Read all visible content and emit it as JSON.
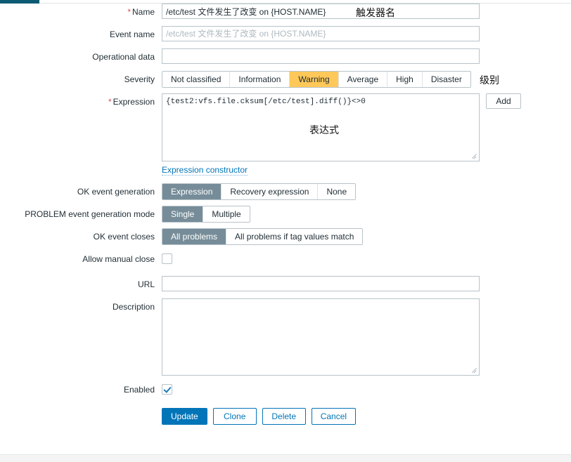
{
  "form": {
    "name": {
      "label": "Name",
      "required": true,
      "value": "/etc/test 文件发生了改变 on {HOST.NAME}",
      "annotation": "触发器名"
    },
    "event_name": {
      "label": "Event name",
      "required": false,
      "value": "",
      "placeholder": "/etc/test 文件发生了改变 on {HOST.NAME}"
    },
    "operational_data": {
      "label": "Operational data",
      "required": false,
      "value": "",
      "placeholder": ""
    },
    "severity": {
      "label": "Severity",
      "annotation": "级别",
      "selected": "Warning",
      "options": [
        "Not classified",
        "Information",
        "Warning",
        "Average",
        "High",
        "Disaster"
      ]
    },
    "expression": {
      "label": "Expression",
      "required": true,
      "value": "{test2:vfs.file.cksum[/etc/test].diff()}<>0",
      "annotation": "表达式",
      "add_label": "Add",
      "constructor_link": "Expression constructor"
    },
    "ok_event_generation": {
      "label": "OK event generation",
      "selected": "Expression",
      "options": [
        "Expression",
        "Recovery expression",
        "None"
      ]
    },
    "problem_event_generation_mode": {
      "label": "PROBLEM event generation mode",
      "selected": "Single",
      "options": [
        "Single",
        "Multiple"
      ]
    },
    "ok_event_closes": {
      "label": "OK event closes",
      "selected": "All problems",
      "options": [
        "All problems",
        "All problems if tag values match"
      ]
    },
    "allow_manual_close": {
      "label": "Allow manual close",
      "checked": false
    },
    "url": {
      "label": "URL",
      "value": "",
      "placeholder": ""
    },
    "description": {
      "label": "Description",
      "value": "",
      "placeholder": ""
    },
    "enabled": {
      "label": "Enabled",
      "checked": true
    }
  },
  "actions": {
    "update": "Update",
    "clone": "Clone",
    "delete": "Delete",
    "cancel": "Cancel"
  },
  "colors": {
    "accent_blue": "#0275b8",
    "selected_gray": "#768d99",
    "warning_amber": "#ffc859",
    "required_red": "#d45353",
    "topbar_teal": "#0c5a73"
  }
}
